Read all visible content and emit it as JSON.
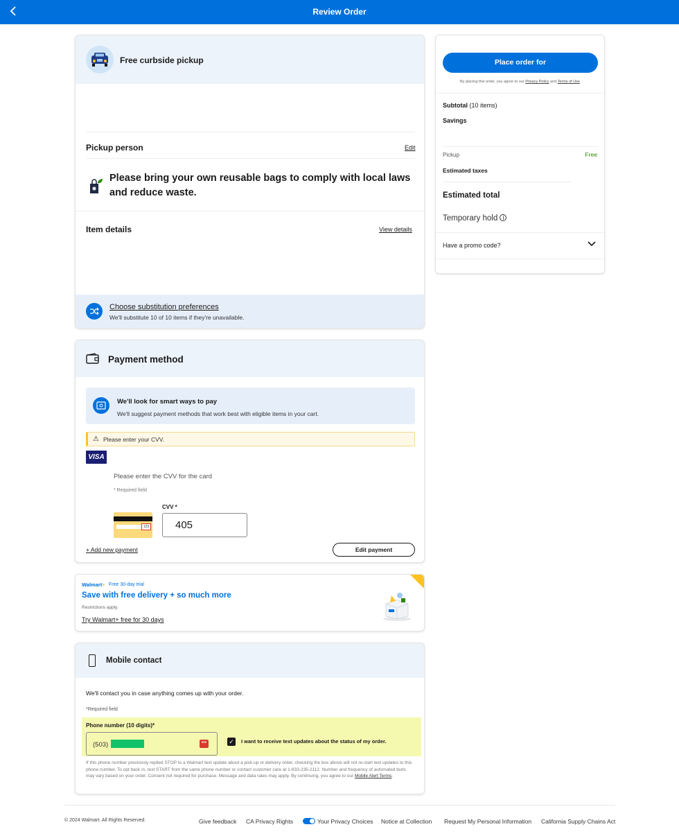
{
  "header": {
    "title": "Review Order",
    "back_icon": "chevron-left-icon"
  },
  "pickup": {
    "title": "Free curbside pickup",
    "pickup_person_label": "Pickup person",
    "edit_label": "Edit",
    "bags_notice": "Please bring your own reusable bags to comply with local laws and reduce waste.",
    "item_details_label": "Item details",
    "view_details_label": "View details",
    "substitution_link": "Choose substitution preferences",
    "substitution_sub": "We'll substitute 10 of 10 items if they're unavailable."
  },
  "payment": {
    "title": "Payment method",
    "smart_title": "We'll look for smart ways to pay",
    "smart_sub": "We'll suggest payment methods that work best with eligible items in your cart.",
    "warning": "Please enter your CVV.",
    "card_brand": "VISA",
    "cvv_prompt": "Please enter the CVV for the card",
    "required_field": "* Required field",
    "card_code_sample": "123",
    "cvv_label": "CVV *",
    "cvv_value": "405",
    "add_payment": "+ Add new payment",
    "edit_payment": "Edit payment"
  },
  "walmart_plus": {
    "brand": "Walmart",
    "brand_mark": "+",
    "trial_label": "Free 30-day trial",
    "headline": "Save with free delivery + so much more",
    "restrictions": "Restrictions apply.",
    "try_link": "Try Walmart+ free for 30 days",
    "accent_color": "#ffc220"
  },
  "mobile": {
    "title": "Mobile contact",
    "contact_text": "We'll contact you in case anything comes up with your order.",
    "required_field": "*Required field",
    "phone_label": "Phone number (10 digits)*",
    "phone_prefix": "(503)",
    "checkbox_label": "I want to receive text updates about the status of my order.",
    "disclaimer": "If this phone number previously replied STOP to a Walmart text update about a pick-up or delivery order, checking the box above will not re-start text updates to this phone number. To opt back in, text START from the same phone number or contact customer care at 1-833-235-2112. Number and frequency of automated texts may vary based on your order. Consent not required for purchase. Message and data rates may apply. By continuing, you agree to our",
    "terms_link": "Mobile Alert Terms",
    "terms_end": "."
  },
  "summary": {
    "place_order": "Place order for",
    "agree_prefix": "By placing this order, you agree to our",
    "privacy_link": "Privacy Policy",
    "and": "and",
    "terms_link": "Terms of Use",
    "subtotal_label": "Subtotal",
    "subtotal_count": "(10 items)",
    "savings_label": "Savings",
    "pickup_label": "Pickup",
    "pickup_value": "Free",
    "taxes_label": "Estimated taxes",
    "estimated_total": "Estimated total",
    "temporary_hold": "Temporary hold",
    "promo_label": "Have a promo code?"
  },
  "footer": {
    "copyright": "© 2024 Walmart. All Rights Reserved.",
    "links": [
      "Give feedback",
      "CA Privacy Rights",
      "Your Privacy Choices",
      "Notice at Collection",
      "Request My Personal Information",
      "California Supply Chains Act"
    ]
  },
  "colors": {
    "brand_blue": "#0071dc",
    "pickup_free_green": "#2a8703",
    "highlight_yellow": "#f5f9b0"
  }
}
